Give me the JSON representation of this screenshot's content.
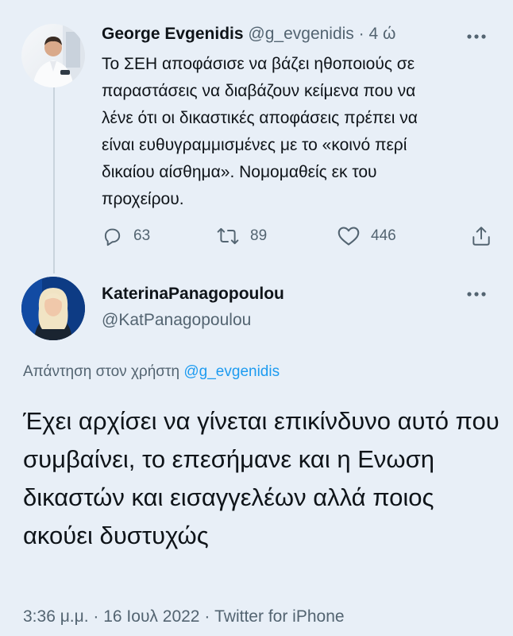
{
  "tweet1": {
    "name": "George Evgenidis",
    "handle": "@g_evgenidis",
    "separator": "·",
    "time": "4 ώ",
    "text": "Το ΣΕΗ αποφάσισε να βάζει ηθοποιούς σε\nπαραστάσεις να διαβάζουν κείμενα που να\nλένε ότι οι δικαστικές αποφάσεις πρέπει να\nείναι ευθυγραμμισμένες με το «κοινό περί\nδικαίου αίσθημα». Νομομαθείς εκ του\nπροχείρου.",
    "replies": "63",
    "retweets": "89",
    "likes": "446",
    "icons": [
      "reply-icon",
      "retweet-icon",
      "like-icon",
      "share-icon",
      "more-icon"
    ]
  },
  "tweet2": {
    "name": "KaterinaPanagopoulou",
    "handle": "@KatPanagopoulou",
    "reply_prefix": "Απάντηση στον χρήστη",
    "reply_mention": "@g_evgenidis",
    "text": "Έχει αρχίσει να γίνεται επικίνδυνο αυτό που συμβαίνει, το επεσήμανε και η Ενωση δικαστών και εισαγγελέων αλλά ποιος ακούει δυστυχώς",
    "timestamp": "3:36 μ.μ. · 16 Ιουλ 2022 · Twitter for iPhone"
  },
  "colors": {
    "background": "#e8eff7",
    "text": "#0f1419",
    "secondary": "#536471",
    "accent": "#1d9bf0",
    "thread_line": "#c9d3dd"
  }
}
